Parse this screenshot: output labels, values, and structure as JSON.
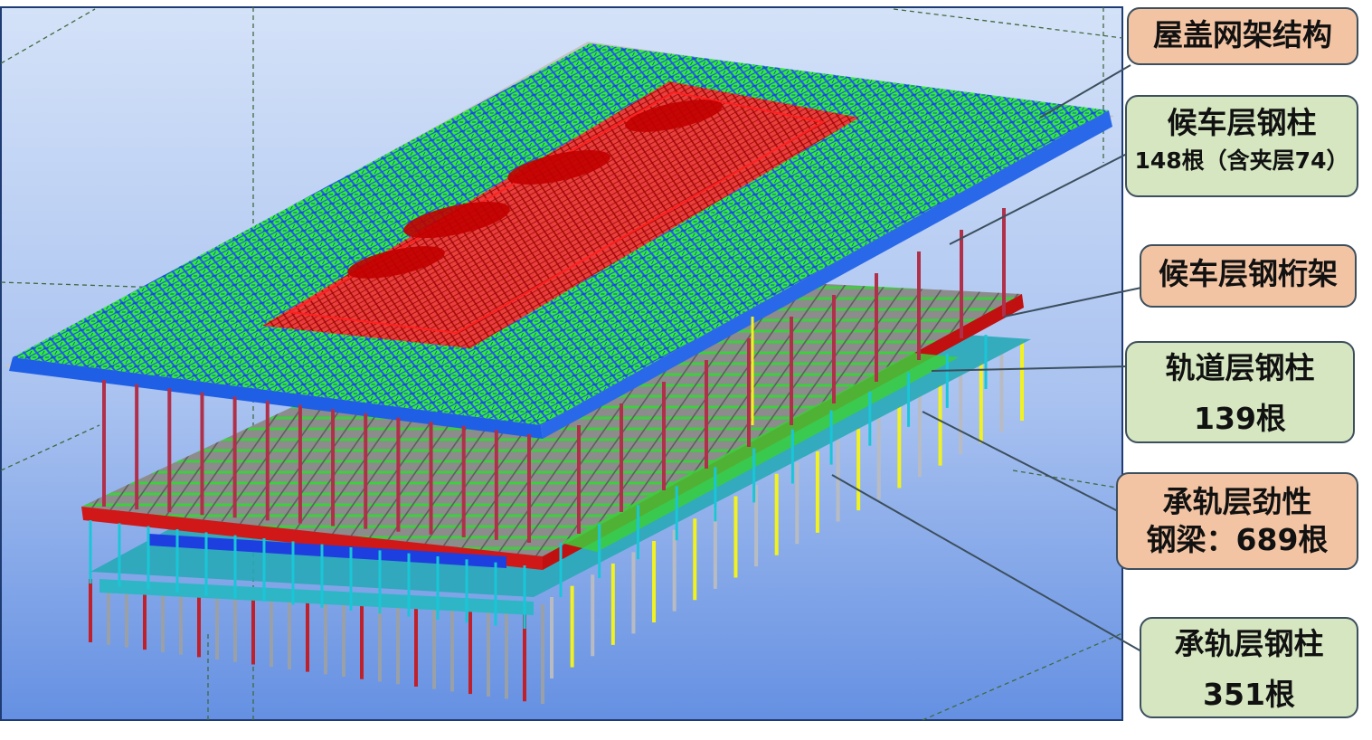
{
  "callouts": {
    "roof": {
      "title": "屋盖网架结构",
      "color": "#f2c4a3"
    },
    "waiting_columns": {
      "title": "候车层钢柱",
      "detail": "148根（含夹层74）",
      "color": "#d5e6c0"
    },
    "waiting_truss": {
      "title": "候车层钢桁架",
      "color": "#f2c4a3"
    },
    "track_columns": {
      "title": "轨道层钢柱",
      "detail": "139根",
      "color": "#d5e6c0"
    },
    "beams": {
      "title_line1": "承轨层劲性",
      "title_line2": "钢梁：689根",
      "color": "#f2c4a3"
    },
    "rail_columns": {
      "title": "承轨层钢柱",
      "detail": "351根",
      "color": "#d5e6c0"
    }
  },
  "colors": {
    "background_top": "#d4e2f8",
    "background_bottom": "#6590e2",
    "roof_grid_green": "#33ee33",
    "roof_edge_blue": "#1a55dd",
    "skylight_red": "#ee1111",
    "column_red": "#b0304a",
    "platform_gray": "#9a9a9a",
    "beam_cyan": "#19c6d8",
    "beam_yellow": "#ffff22",
    "leader_line": "#3c4f5e"
  }
}
